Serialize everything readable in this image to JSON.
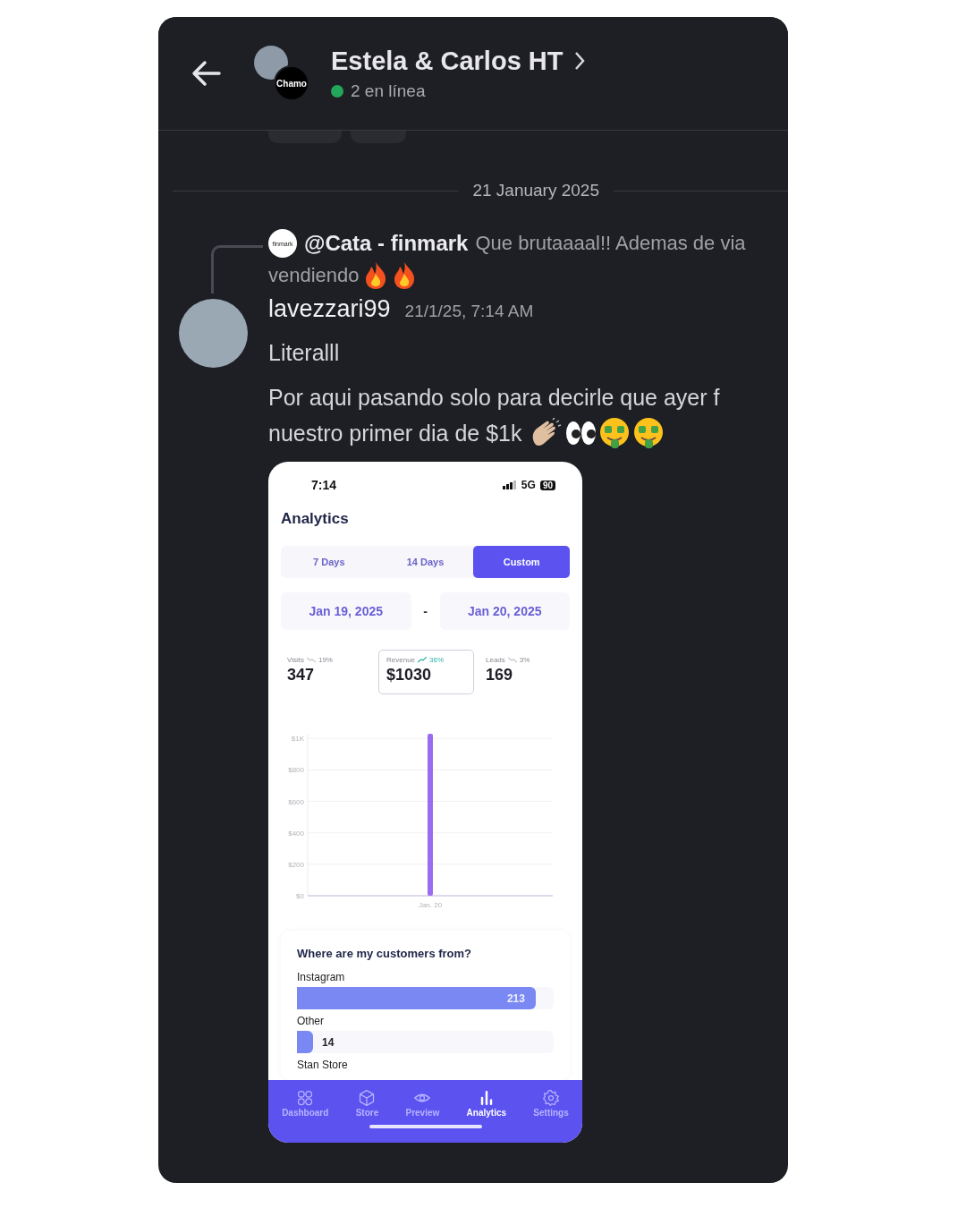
{
  "header": {
    "title": "Estela & Carlos HT",
    "status": "2 en línea",
    "online": true,
    "group_avatar_text": "Chamo"
  },
  "reaction_chips": [
    {
      "kind": "partial"
    },
    {
      "kind": "partial"
    }
  ],
  "date_divider": "21 January 2025",
  "reply": {
    "avatar_text": "finmark",
    "author": "@Cata - finmark",
    "text": "Que brutaaaal!! Ademas de via",
    "text_line_2": "vendiendo",
    "emojis": [
      {
        "kind": "fire"
      },
      {
        "kind": "fire"
      }
    ]
  },
  "message": {
    "author": "lavezzari99",
    "time": "21/1/25, 7:14 AM",
    "lines": [
      "Literalll"
    ],
    "paragraph_lines": [
      "Por aqui pasando solo para decirle que ayer f",
      "nuestro primer dia de $1k"
    ],
    "emojis": [
      {
        "kind": "clap"
      },
      {
        "kind": "eyes"
      },
      {
        "kind": "money"
      },
      {
        "kind": "money"
      }
    ]
  },
  "phone_screenshot": {
    "status_bar": {
      "time": "7:14",
      "network": "5G",
      "battery": "90"
    },
    "title": "Analytics",
    "tabs": [
      {
        "label": "7 Days",
        "selected": false
      },
      {
        "label": "14 Days",
        "selected": false
      },
      {
        "label": "Custom",
        "selected": true
      }
    ],
    "date_range": {
      "start": "Jan 19, 2025",
      "separator": "-",
      "end": "Jan 20, 2025"
    },
    "stats": [
      {
        "label": "Visits",
        "change": "19%",
        "kind": "down",
        "value": "347",
        "selected": false
      },
      {
        "label": "Revenue",
        "change": "36%",
        "kind": "up",
        "value": "$1030",
        "selected": true
      },
      {
        "label": "Leads",
        "change": "3%",
        "kind": "down",
        "value": "169",
        "selected": false
      }
    ],
    "chart_data": {
      "type": "bar",
      "categories": [
        "Jan. 20"
      ],
      "values": [
        1030
      ],
      "ylim": [
        0,
        1030
      ],
      "grid": true,
      "yticks": [
        {
          "value": 0,
          "label": "$0"
        },
        {
          "value": 200,
          "label": "$200"
        },
        {
          "value": 400,
          "label": "$400"
        },
        {
          "value": 600,
          "label": "$600"
        },
        {
          "value": 800,
          "label": "$800"
        },
        {
          "value": 1000,
          "label": "$1K"
        }
      ]
    },
    "customers": {
      "title": "Where are my customers from?",
      "sources": [
        {
          "label": "Instagram",
          "count": "213",
          "level": 0.93
        },
        {
          "label": "Other",
          "count": "14",
          "level": 0.06
        },
        {
          "label": "Stan Store"
        }
      ]
    },
    "nav": [
      {
        "label": "Dashboard",
        "kind": "grid",
        "selected": false
      },
      {
        "label": "Store",
        "kind": "box",
        "selected": false
      },
      {
        "label": "Preview",
        "kind": "eye",
        "selected": false
      },
      {
        "label": "Analytics",
        "kind": "bars",
        "selected": true
      },
      {
        "label": "Settings",
        "kind": "gear",
        "selected": false
      }
    ]
  }
}
